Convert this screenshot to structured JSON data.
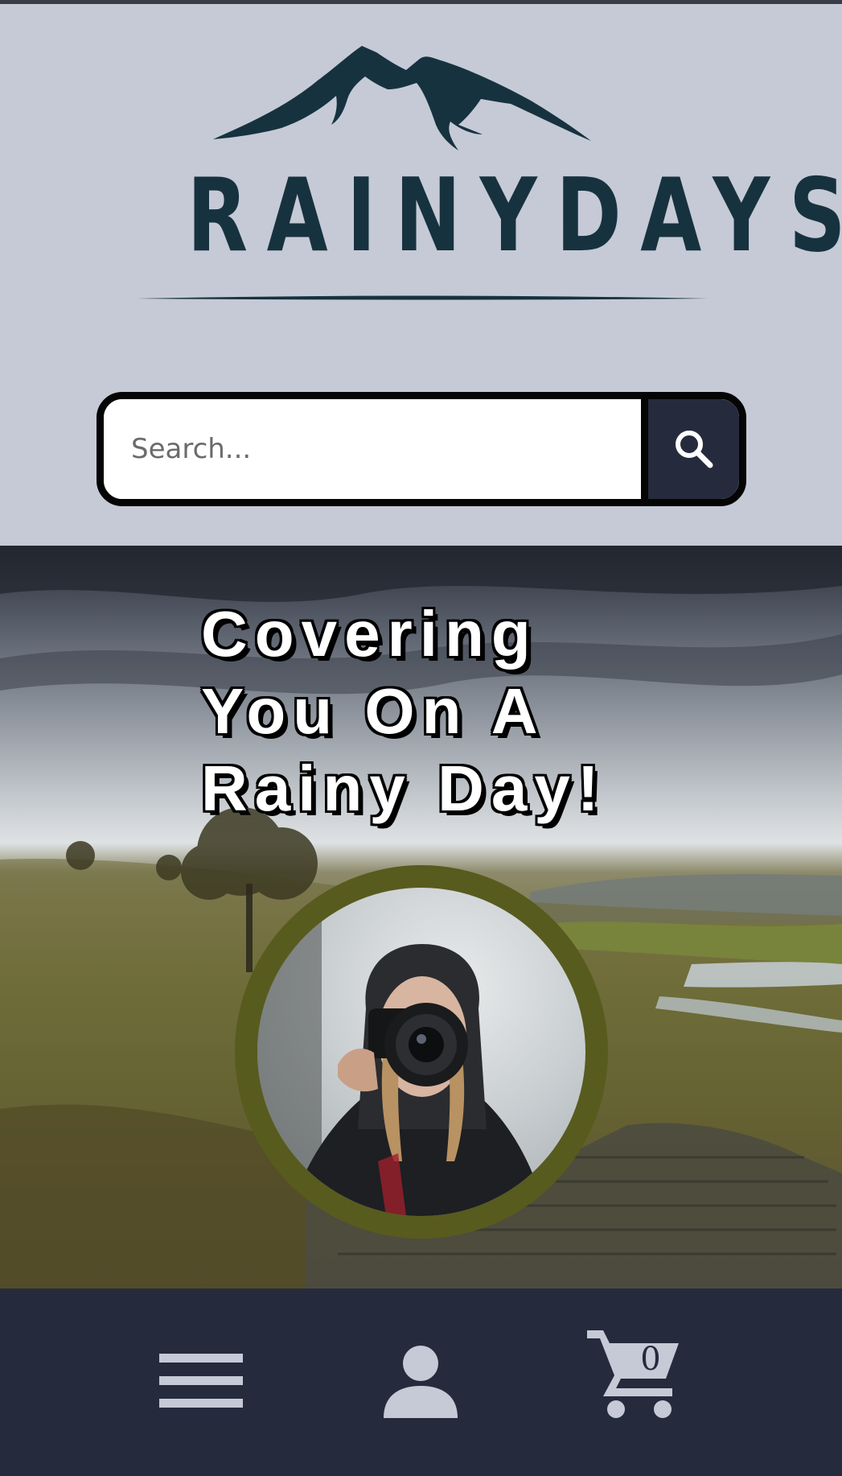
{
  "brand": {
    "name": "RAINYDAYS",
    "color": "#17323f"
  },
  "search": {
    "placeholder": "Search...",
    "value": "",
    "button_icon": "search-icon"
  },
  "hero": {
    "heading_lines": [
      "Covering",
      "You On A",
      "Rainy Day!"
    ],
    "photo_subject": "hooded photographer with camera in rain"
  },
  "bottom_nav": {
    "items": [
      {
        "name": "menu",
        "icon": "hamburger-menu-icon"
      },
      {
        "name": "account",
        "icon": "user-icon"
      },
      {
        "name": "cart",
        "icon": "shopping-cart-icon"
      }
    ],
    "cart_count": "0"
  },
  "colors": {
    "header_bg": "#c5cad6",
    "nav_bg": "#252b3d",
    "accent_olive": "#585b1e",
    "icon_light": "#c5cad6"
  }
}
